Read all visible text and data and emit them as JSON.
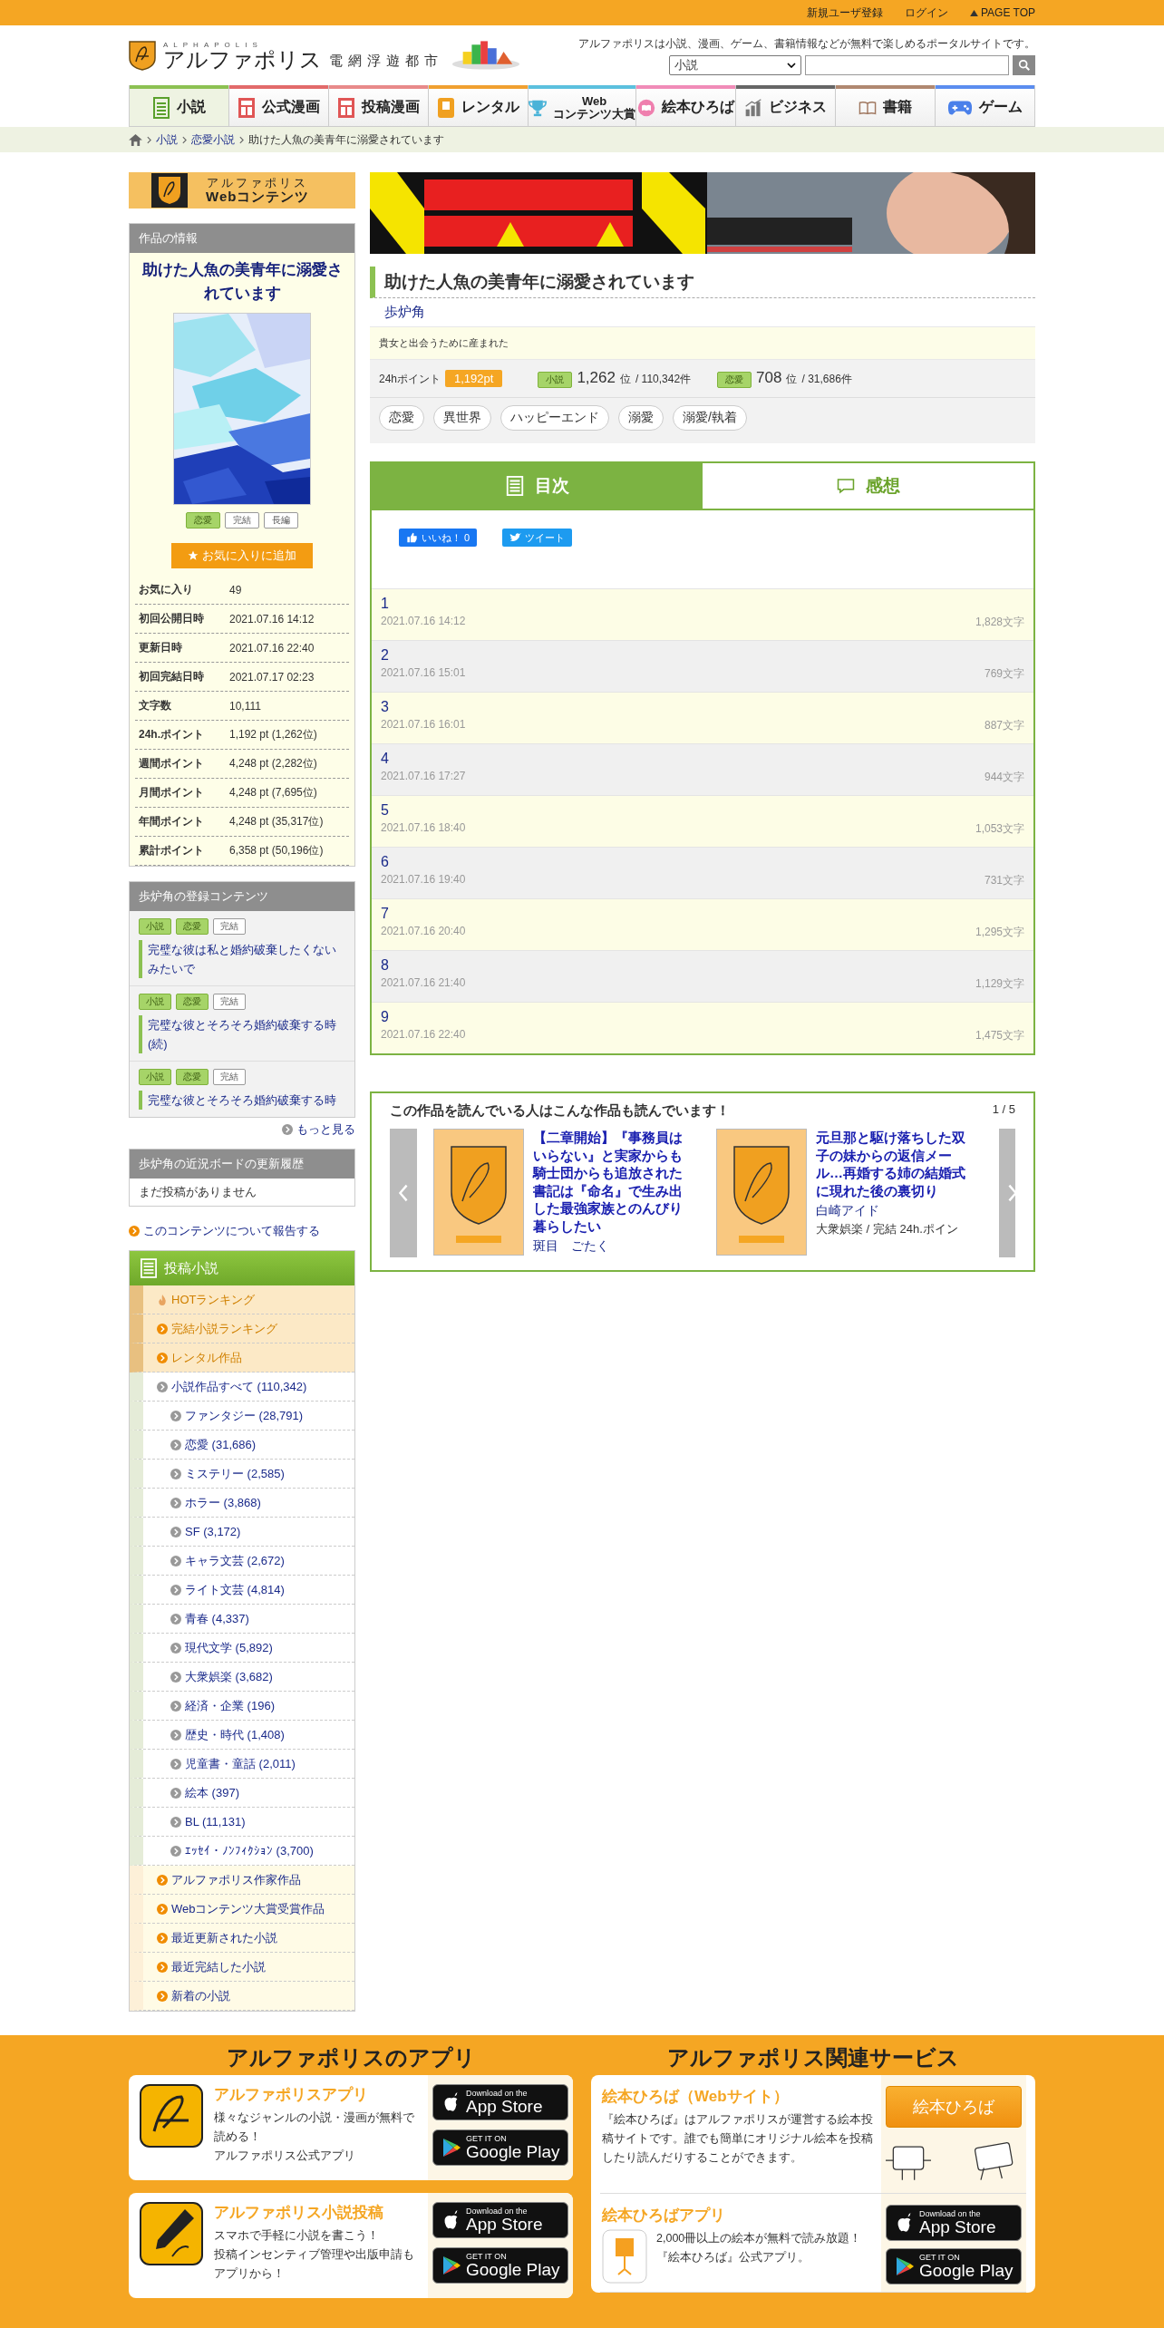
{
  "top_bar": {
    "links": [
      "新規ユーザ登録",
      "ログイン",
      "PAGE TOP"
    ]
  },
  "header": {
    "logo_latin": "ALPHAPOLIS",
    "logo": "アルファポリス",
    "tagline": "電網浮遊都市",
    "description": "アルファポリスは小説、漫画、ゲーム、書籍情報などが無料で楽しめるポータルサイトです。",
    "search": {
      "category": "小説"
    }
  },
  "nav_tabs": [
    {
      "lines": [
        "小説"
      ],
      "kind": "doc",
      "color": "#8cc152",
      "selected": true
    },
    {
      "lines": [
        "公式漫画"
      ],
      "kind": "manga",
      "color": "#e26a6a",
      "selected": false
    },
    {
      "lines": [
        "投稿漫画"
      ],
      "kind": "manga",
      "color": "#e88a8a",
      "selected": false
    },
    {
      "lines": [
        "レンタル"
      ],
      "kind": "rental",
      "color": "#f0a030",
      "selected": false
    },
    {
      "lines": [
        "Web",
        "コンテンツ大賞"
      ],
      "kind": "trophy",
      "color": "#5bc0de",
      "selected": false
    },
    {
      "lines": [
        "絵本ひろば"
      ],
      "kind": "picturebook",
      "color": "#f08cb8",
      "selected": false
    },
    {
      "lines": [
        "ビジネス"
      ],
      "kind": "chart",
      "color": "#666666",
      "selected": false
    },
    {
      "lines": [
        "書籍"
      ],
      "kind": "book",
      "color": "#b08870",
      "selected": false
    },
    {
      "lines": [
        "ゲーム"
      ],
      "kind": "gamepad",
      "color": "#5b8def",
      "selected": false
    }
  ],
  "breadcrumb": [
    "小説",
    "恋愛小説",
    "助けた人魚の美青年に溺愛されています"
  ],
  "sidebar": {
    "banner": {
      "line1": "アルファポリス",
      "line2": "Webコンテンツ"
    },
    "info": {
      "heading": "作品の情報",
      "title": "助けた人魚の美青年に溺愛されています",
      "tags": [
        {
          "label": "恋愛",
          "kind": "genre"
        },
        {
          "label": "完結",
          "kind": "status"
        },
        {
          "label": "長編",
          "kind": "status"
        }
      ],
      "favorite_button": "お気に入りに追加",
      "stats": [
        {
          "label": "お気に入り",
          "value": "49"
        },
        {
          "label": "初回公開日時",
          "value": "2021.07.16 14:12"
        },
        {
          "label": "更新日時",
          "value": "2021.07.16 22:40"
        },
        {
          "label": "初回完結日時",
          "value": "2021.07.17 02:23"
        },
        {
          "label": "文字数",
          "value": "10,111"
        },
        {
          "label": "24h.ポイント",
          "value": "1,192 pt (1,262位)"
        },
        {
          "label": "週間ポイント",
          "value": "4,248 pt (2,282位)"
        },
        {
          "label": "月間ポイント",
          "value": "4,248 pt (7,695位)"
        },
        {
          "label": "年間ポイント",
          "value": "4,248 pt (35,317位)"
        },
        {
          "label": "累計ポイント",
          "value": "6,358 pt (50,196位)"
        }
      ]
    },
    "registered": {
      "heading": "歩炉角の登録コンテンツ",
      "items": [
        {
          "tags": [
            {
              "label": "小説",
              "kind": "genre"
            },
            {
              "label": "恋愛",
              "kind": "genre"
            },
            {
              "label": "完結",
              "kind": "status"
            }
          ],
          "title": "完璧な彼は私と婚約破棄したくないみたいで"
        },
        {
          "tags": [
            {
              "label": "小説",
              "kind": "genre"
            },
            {
              "label": "恋愛",
              "kind": "genre"
            },
            {
              "label": "完結",
              "kind": "status"
            }
          ],
          "title": "完璧な彼とそろそろ婚約破棄する時(続)"
        },
        {
          "tags": [
            {
              "label": "小説",
              "kind": "genre"
            },
            {
              "label": "恋愛",
              "kind": "genre"
            },
            {
              "label": "完結",
              "kind": "status"
            }
          ],
          "title": "完璧な彼とそろそろ婚約破棄する時"
        }
      ],
      "more": "もっと見る"
    },
    "board": {
      "heading": "歩炉角の近況ボードの更新履歴",
      "empty": "まだ投稿がありません"
    },
    "report_link": "このコンテンツについて報告する",
    "nav": {
      "heading": "投稿小説",
      "items": [
        {
          "label": "HOTランキング",
          "kind": "hot"
        },
        {
          "label": "完結小説ランキング",
          "kind": "ranking"
        },
        {
          "label": "レンタル作品",
          "kind": "ranking"
        },
        {
          "label": "小説作品すべて (110,342)",
          "kind": "category",
          "children": [
            {
              "label": "ファンタジー (28,791)"
            },
            {
              "label": "恋愛 (31,686)"
            },
            {
              "label": "ミステリー (2,585)"
            },
            {
              "label": "ホラー (3,868)"
            },
            {
              "label": "SF (3,172)"
            },
            {
              "label": "キャラ文芸 (2,672)"
            },
            {
              "label": "ライト文芸 (4,814)"
            },
            {
              "label": "青春 (4,337)"
            },
            {
              "label": "現代文学 (5,892)"
            },
            {
              "label": "大衆娯楽 (3,682)"
            },
            {
              "label": "経済・企業 (196)"
            },
            {
              "label": "歴史・時代 (1,408)"
            },
            {
              "label": "児童書・童話 (2,011)"
            },
            {
              "label": "絵本 (397)"
            },
            {
              "label": "BL (11,131)"
            },
            {
              "label": "ｴｯｾｲ・ﾉﾝﾌｨｸｼｮﾝ (3,700)"
            }
          ]
        },
        {
          "label": "アルファポリス作家作品",
          "kind": "extra"
        },
        {
          "label": "Webコンテンツ大賞受賞作品",
          "kind": "extra"
        },
        {
          "label": "最近更新された小説",
          "kind": "extra"
        },
        {
          "label": "最近完結した小説",
          "kind": "extra"
        },
        {
          "label": "新着の小説",
          "kind": "extra"
        }
      ]
    }
  },
  "work": {
    "title": "助けた人魚の美青年に溺愛されています",
    "author": "歩炉角",
    "catchphrase": "貴女と出会うために産まれた",
    "points": {
      "label": "24hポイント",
      "value": "1,192pt"
    },
    "ranks": [
      {
        "genre": "小説",
        "rank": "1,262",
        "unit": "位",
        "total": "/ 110,342件"
      },
      {
        "genre": "恋愛",
        "rank": "708",
        "unit": "位",
        "total": "/ 31,686件"
      }
    ],
    "tags": [
      "恋愛",
      "異世界",
      "ハッピーエンド",
      "溺愛",
      "溺愛/執着"
    ]
  },
  "tabs": [
    {
      "label": "目次",
      "kind": "toc",
      "selected": true
    },
    {
      "label": "感想",
      "kind": "comment",
      "selected": false
    }
  ],
  "social": {
    "like": "いいね！ 0",
    "tweet": "ツイート"
  },
  "chapters": [
    {
      "title": "1",
      "date": "2021.07.16 14:12",
      "chars": "1,828文字"
    },
    {
      "title": "2",
      "date": "2021.07.16 15:01",
      "chars": "769文字"
    },
    {
      "title": "3",
      "date": "2021.07.16 16:01",
      "chars": "887文字"
    },
    {
      "title": "4",
      "date": "2021.07.16 17:27",
      "chars": "944文字"
    },
    {
      "title": "5",
      "date": "2021.07.16 18:40",
      "chars": "1,053文字"
    },
    {
      "title": "6",
      "date": "2021.07.16 19:40",
      "chars": "731文字"
    },
    {
      "title": "7",
      "date": "2021.07.16 20:40",
      "chars": "1,295文字"
    },
    {
      "title": "8",
      "date": "2021.07.16 21:40",
      "chars": "1,129文字"
    },
    {
      "title": "9",
      "date": "2021.07.16 22:40",
      "chars": "1,475文字"
    }
  ],
  "recommend": {
    "heading": "この作品を読んでいる人はこんな作品も読んでいます！",
    "page": "1 / 5",
    "items": [
      {
        "title": "【二章開始】『事務員はいらない』と実家からも騎士団からも追放された書記は『命名』で生み出した最強家族とのんびり暮らしたい",
        "author": "斑目　ごたく"
      },
      {
        "title": "元旦那と駆け落ちした双子の妹からの返信メール…再婚する姉の結婚式に現れた後の裏切り",
        "author": "白崎アイド",
        "meta": "大衆娯楽 / 完結 24h.ポイン"
      }
    ]
  },
  "footer": {
    "apps_heading": "アルファポリスのアプリ",
    "apps": [
      {
        "name": "アルファポリスアプリ",
        "kind": "reader",
        "description": [
          "様々なジャンルの小説・漫画が無料で読める！",
          "アルファポリス公式アプリ"
        ],
        "badges": [
          {
            "kind": "apple",
            "small": "Download on the",
            "big": "App Store"
          },
          {
            "kind": "google",
            "small": "GET IT ON",
            "big": "Google Play"
          }
        ]
      },
      {
        "name": "アルファポリス小説投稿",
        "kind": "writer",
        "description": [
          "スマホで手軽に小説を書こう！",
          "投稿インセンティブ管理や出版申請もアプリから！"
        ],
        "badges": [
          {
            "kind": "apple",
            "small": "Download on the",
            "big": "App Store"
          },
          {
            "kind": "google",
            "small": "GET IT ON",
            "big": "Google Play"
          }
        ]
      }
    ],
    "services_heading": "アルファポリス関連サービス",
    "services": [
      {
        "name": "絵本ひろば（Webサイト）",
        "kind": "website",
        "description": [
          "『絵本ひろば』はアルファポリスが運営する絵本投稿サイトです。誰でも簡単にオリジナル絵本を投稿したり読んだりすることができます。"
        ],
        "button": "絵本ひろば"
      },
      {
        "name": "絵本ひろばアプリ",
        "kind": "app",
        "description": [
          "2,000冊以上の絵本が無料で読み放題！",
          "『絵本ひろば』公式アプリ。"
        ],
        "badges": [
          {
            "kind": "apple",
            "small": "Download on the",
            "big": "App Store"
          },
          {
            "kind": "google",
            "small": "GET IT ON",
            "big": "Google Play"
          }
        ]
      }
    ]
  }
}
